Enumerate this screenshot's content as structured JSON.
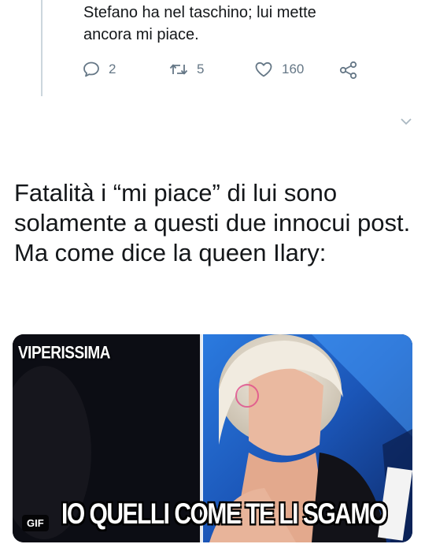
{
  "quoted_tweet": {
    "text_lines": [
      "Stefano ha nel taschino; lui mette",
      "ancora mi piace."
    ],
    "actions": {
      "replies": "2",
      "retweets": "5",
      "likes": "160"
    }
  },
  "tweet": {
    "paragraphs": [
      "Fatalità i “mi piace” di lui sono solamente a questi due innocui post.",
      "Ma come dice la queen Ilary:"
    ],
    "media": {
      "watermark": "VIPERISSIMA",
      "caption": "IO QUELLI COME TE LI SGAMO",
      "badge": "GIF"
    }
  },
  "colors": {
    "text": "#14171a",
    "muted": "#657786",
    "divider": "#ccd6dd",
    "stage_blue": "#1f6fd8"
  },
  "icons": {
    "reply": "reply-icon",
    "retweet": "retweet-icon",
    "like": "heart-icon",
    "share": "share-icon",
    "more": "chevron-down-icon"
  }
}
